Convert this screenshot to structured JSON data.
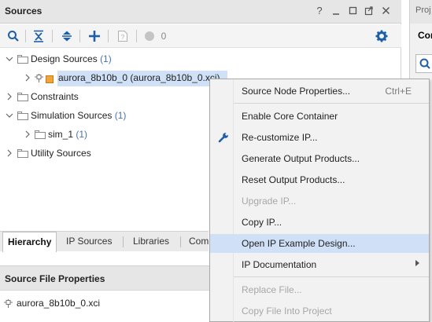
{
  "sources_panel": {
    "title": "Sources",
    "header_icons": [
      "help-icon",
      "minimize-icon",
      "restore-icon",
      "float-icon",
      "close-icon"
    ],
    "toolbar": {
      "items": [
        "search-icon",
        "collapse-all-icon",
        "expand-all-icon",
        "add-icon",
        "unknown-source-icon",
        "status-circle-icon"
      ],
      "count": "0"
    },
    "tree": [
      {
        "label": "Design Sources",
        "count": "(1)",
        "expanded": true
      },
      {
        "label": "aurora_8b10b_0 (aurora_8b10b_0.xci)",
        "count": "",
        "selected": true
      },
      {
        "label": "Constraints",
        "count": ""
      },
      {
        "label": "Simulation Sources",
        "count": "(1)",
        "expanded": true
      },
      {
        "label": "sim_1",
        "count": "(1)"
      },
      {
        "label": "Utility Sources",
        "count": ""
      }
    ],
    "tabs": [
      "Hierarchy",
      "IP Sources",
      "Libraries",
      "Com"
    ]
  },
  "properties_panel": {
    "title": "Source File Properties",
    "file": "aurora_8b10b_0.xci"
  },
  "right_panel": {
    "title": "Proj",
    "subtitle": "Cor"
  },
  "context_menu": {
    "items": [
      {
        "label": "Source Node Properties...",
        "shortcut": "Ctrl+E"
      },
      {
        "label": "Enable Core Container"
      },
      {
        "label": "Re-customize IP...",
        "icon": "wrench-icon"
      },
      {
        "label": "Generate Output Products..."
      },
      {
        "label": "Reset Output Products..."
      },
      {
        "label": "Upgrade IP...",
        "disabled": true
      },
      {
        "label": "Copy IP..."
      },
      {
        "label": "Open IP Example Design...",
        "hover": true
      },
      {
        "label": "IP Documentation",
        "submenu": true
      },
      {
        "label": "Replace File...",
        "disabled": true
      },
      {
        "label": "Copy File Into Project",
        "disabled": true
      }
    ]
  },
  "colors": {
    "selection": "#cfe0f7",
    "accent_blue": "#1f5fa8",
    "count_blue": "#4a72b0",
    "disabled_text": "#a7a7a7"
  }
}
